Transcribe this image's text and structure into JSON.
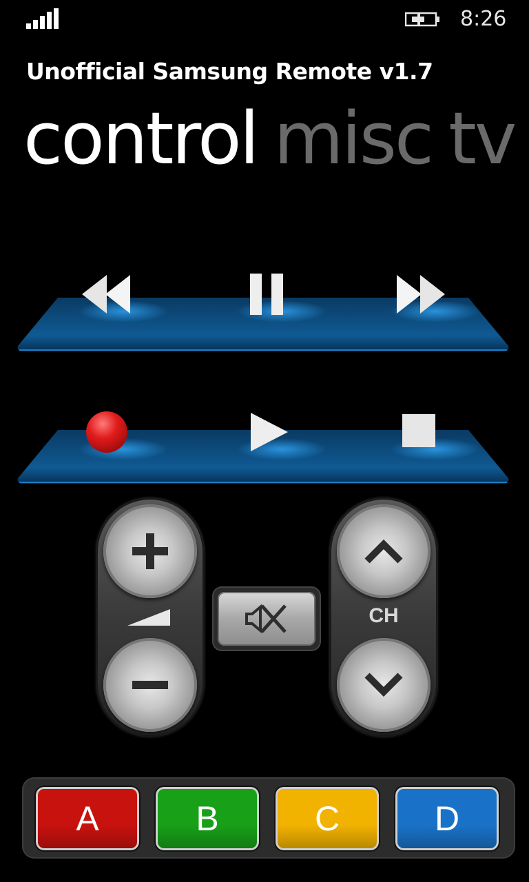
{
  "status_bar": {
    "time": "8:26",
    "signal_icon": "signal-strength-icon",
    "battery_icon": "battery-charging-icon"
  },
  "app": {
    "title": "Unofficial Samsung Remote v1.7"
  },
  "pivot": {
    "tabs": [
      {
        "label": "control",
        "active": true
      },
      {
        "label": "misc",
        "active": false
      },
      {
        "label": "tv",
        "active": false
      }
    ]
  },
  "media_row_1": [
    "rewind-icon",
    "pause-icon",
    "fast-forward-icon"
  ],
  "media_row_2": [
    "record-icon",
    "play-icon",
    "stop-icon"
  ],
  "volume": {
    "up_icon": "plus-icon",
    "level_icon": "volume-level-icon",
    "down_icon": "minus-icon"
  },
  "mute": {
    "icon": "mute-icon"
  },
  "channel": {
    "up_icon": "chevron-up-icon",
    "label": "CH",
    "down_icon": "chevron-down-icon"
  },
  "color_keys": [
    {
      "label": "A",
      "color": "#c8120e"
    },
    {
      "label": "B",
      "color": "#18a019"
    },
    {
      "label": "C",
      "color": "#f2b200"
    },
    {
      "label": "D",
      "color": "#1a72c8"
    }
  ],
  "colors": {
    "platform_blue": "#0a4f86",
    "record_red": "#e01c1c"
  }
}
